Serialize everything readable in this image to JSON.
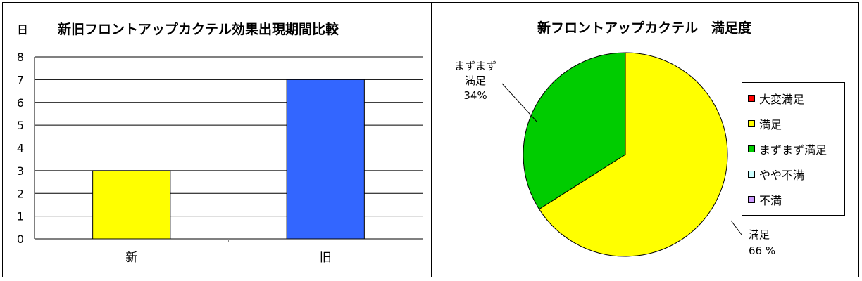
{
  "chart_data": [
    {
      "type": "bar",
      "title": "新旧フロントアップカクテル効果出現期間比較",
      "ylabel": "日",
      "categories": [
        "新",
        "旧"
      ],
      "values": [
        3,
        7
      ],
      "colors": [
        "#ffff00",
        "#3366ff"
      ],
      "ylim": [
        0,
        8
      ],
      "yticks": [
        "0",
        "1",
        "2",
        "3",
        "4",
        "5",
        "6",
        "7",
        "8"
      ],
      "grid": true
    },
    {
      "type": "pie",
      "title": "新フロントアップカクテル　満足度",
      "labels": [
        "大変満足",
        "満足",
        "まずまず満足",
        "やや不満",
        "不満"
      ],
      "values": [
        0,
        66,
        34,
        0,
        0
      ],
      "colors": [
        "#ff0000",
        "#ffff00",
        "#00cc00",
        "#ccffff",
        "#cc99ff"
      ],
      "data_labels": [
        {
          "text_lines": [
            "満足",
            "66 %"
          ]
        },
        {
          "text_lines": [
            "まずまず",
            "満足",
            "34%"
          ]
        }
      ],
      "legend_position": "right"
    }
  ]
}
